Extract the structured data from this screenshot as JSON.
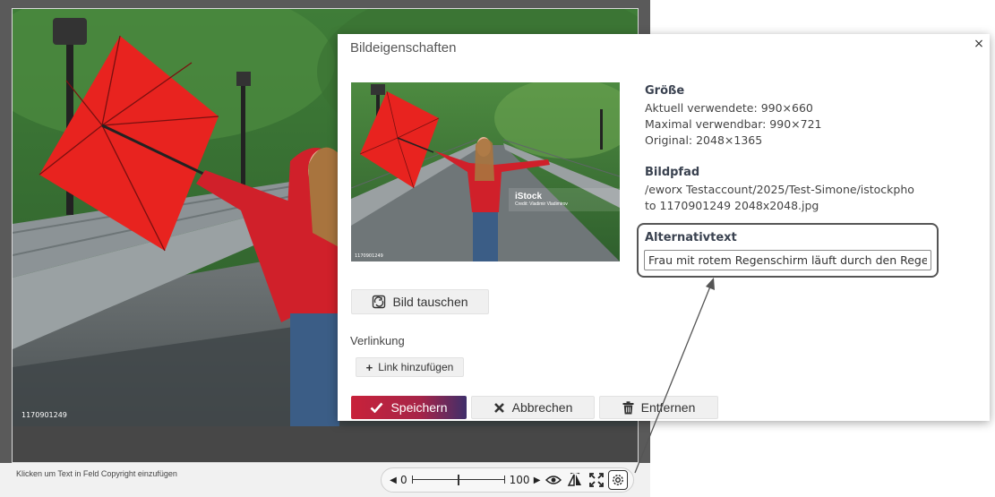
{
  "editor": {
    "image_id": "1170901249",
    "copyright_hint": "Klicken um Text in Feld Copyright einzufügen"
  },
  "toolbar": {
    "zoom_min": "0",
    "zoom_max": "100",
    "zoom_value": 0.5,
    "icons": [
      "chevron-left-icon",
      "chevron-right-icon",
      "eye-icon",
      "flip-icon",
      "fullscreen-icon",
      "gear-icon"
    ]
  },
  "dialog": {
    "title": "Bildeigenschaften",
    "close": "×",
    "preview": {
      "brand": "iStock",
      "credit": "Credit: Vladimir Vladimirov",
      "corner_id": "1170901249"
    },
    "swap_button": "Bild tauschen",
    "link_label": "Verlinkung",
    "add_link_button": "Link hinzufügen",
    "save_button": "Speichern",
    "cancel_button": "Abbrechen",
    "remove_button": "Entfernen",
    "size": {
      "heading": "Größe",
      "current": "Aktuell verwendete: 990×660",
      "max": "Maximal verwendbar: 990×721",
      "original": "Original: 2048×1365"
    },
    "path": {
      "heading": "Bildpfad",
      "line1": "/eworx Testaccount/2025/Test-Simone/istockpho",
      "line2": "to 1170901249 2048x2048.jpg"
    },
    "alt_text": {
      "heading": "Alternativtext",
      "value": "Frau mit rotem Regenschirm läuft durch den Regen"
    }
  },
  "colors": {
    "save_gradient_start": "#c8223a",
    "save_gradient_end": "#3f2f6b",
    "umbrella": "#e8231f",
    "jacket": "#d0202a"
  }
}
